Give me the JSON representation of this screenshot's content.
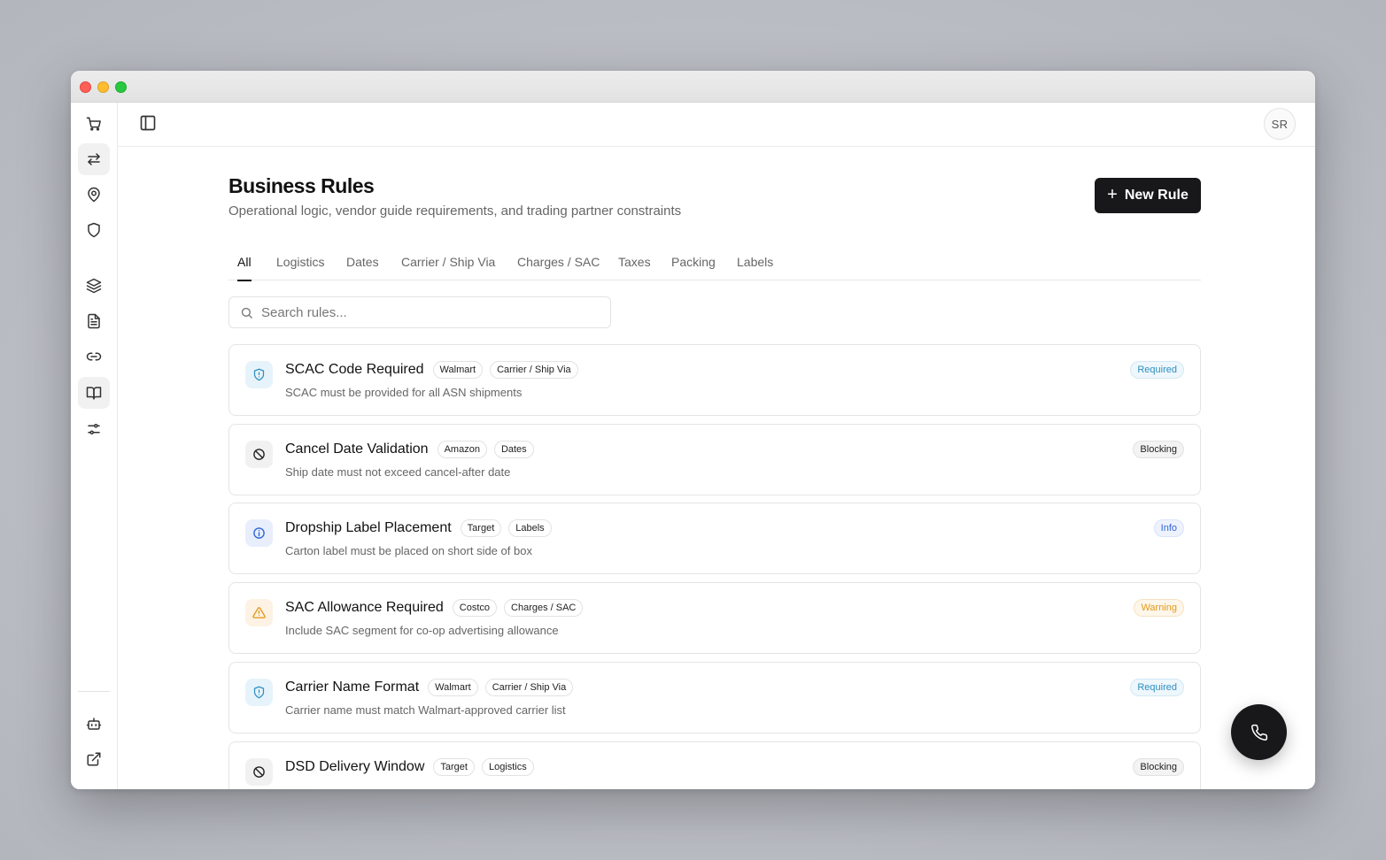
{
  "window": {
    "controls": [
      "close",
      "minimize",
      "maximize"
    ]
  },
  "rail": {
    "items": [
      {
        "icon": "cart-icon",
        "name": "rail-orders"
      },
      {
        "icon": "arrows-exchange-icon",
        "name": "rail-transactions"
      },
      {
        "icon": "map-pin-icon",
        "name": "rail-locations"
      },
      {
        "icon": "shield-icon",
        "name": "rail-compliance"
      },
      {
        "icon": "layers-icon",
        "name": "rail-layers"
      },
      {
        "icon": "document-icon",
        "name": "rail-documents"
      },
      {
        "icon": "link-icon",
        "name": "rail-connections"
      },
      {
        "icon": "book-open-icon",
        "name": "rail-business-rules",
        "active": true
      },
      {
        "icon": "sliders-icon",
        "name": "rail-settings"
      }
    ],
    "bottom_items": [
      {
        "icon": "bot-icon",
        "name": "rail-assistant"
      },
      {
        "icon": "external-link-icon",
        "name": "rail-open-external"
      }
    ]
  },
  "topbar": {
    "avatar_initials": "SR"
  },
  "page": {
    "title": "Business Rules",
    "subtitle": "Operational logic, vendor guide requirements, and trading partner constraints",
    "new_rule_label": "New Rule"
  },
  "tabs": [
    "All",
    "Logistics",
    "Dates",
    "Carrier / Ship Via",
    "Charges / SAC",
    "Taxes",
    "Packing",
    "Labels"
  ],
  "active_tab": "All",
  "search": {
    "placeholder": "Search rules..."
  },
  "rules": [
    {
      "title": "SCAC Code Required",
      "partner": "Walmart",
      "category": "Carrier / Ship Via",
      "description": "SCAC must be provided for all ASN shipments",
      "status": "Required",
      "icon": "shield-icon"
    },
    {
      "title": "Cancel Date Validation",
      "partner": "Amazon",
      "category": "Dates",
      "description": "Ship date must not exceed cancel-after date",
      "status": "Blocking",
      "icon": "ban-icon"
    },
    {
      "title": "Dropship Label Placement",
      "partner": "Target",
      "category": "Labels",
      "description": "Carton label must be placed on short side of box",
      "status": "Info",
      "icon": "info-icon"
    },
    {
      "title": "SAC Allowance Required",
      "partner": "Costco",
      "category": "Charges / SAC",
      "description": "Include SAC segment for co-op advertising allowance",
      "status": "Warning",
      "icon": "warning-icon"
    },
    {
      "title": "Carrier Name Format",
      "partner": "Walmart",
      "category": "Carrier / Ship Via",
      "description": "Carrier name must match Walmart-approved carrier list",
      "status": "Required",
      "icon": "shield-icon"
    },
    {
      "title": "DSD Delivery Window",
      "partner": "Target",
      "category": "Logistics",
      "description": "",
      "status": "Blocking",
      "icon": "ban-icon"
    }
  ],
  "status_colors": {
    "Required": "#2e8fc0",
    "Blocking": "#222222",
    "Info": "#2f66d6",
    "Warning": "#e49a1b"
  },
  "fab": {
    "icon": "phone-icon"
  }
}
